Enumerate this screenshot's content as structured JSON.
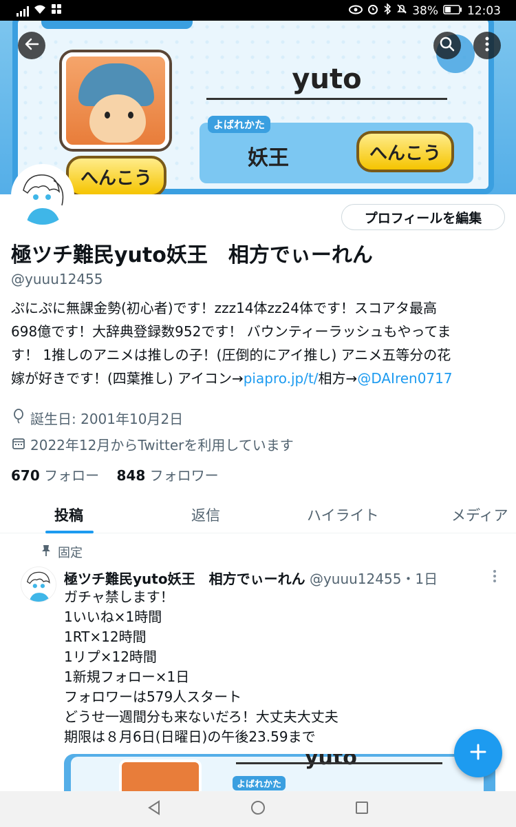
{
  "status_bar": {
    "battery": "38%",
    "time": "12:03"
  },
  "banner": {
    "name_text": "yuto",
    "yobarekata_label": "よばれかた",
    "yobarekata_value": "妖王",
    "henkou_button_1": "へんこう",
    "henkou_button_2": "へんこう"
  },
  "header": {
    "back_icon": "arrow-left-icon",
    "search_icon": "search-icon",
    "more_icon": "more-vertical-icon"
  },
  "profile": {
    "edit_button": "プロフィールを編集",
    "display_name": "極ツチ難民yuto妖王　相方でぃーれん",
    "handle": "@yuuu12455",
    "bio_line1": "ぷにぷに無課金勢(初心者)です！zzz14体zz24体です！スコアタ最高",
    "bio_line2": "698億です！大辞典登録数952です！ バウンティーラッシュもやってま",
    "bio_line3": "す！ 1推しのアニメは推しの子！(圧倒的にアイ推し) アニメ五等分の花",
    "bio_line4_prefix": "嫁が好きです！(四葉推し) アイコン→",
    "bio_link1": "piapro.jp/t/",
    "bio_line4_mid": "相方→",
    "bio_link2": "@DAIren0717",
    "birthday": "誕生日: 2001年10月2日",
    "joined": "2022年12月からTwitterを利用しています",
    "following_count": "670",
    "following_label": "フォロー",
    "followers_count": "848",
    "followers_label": "フォロワー"
  },
  "tabs": [
    {
      "label": "投稿"
    },
    {
      "label": "返信"
    },
    {
      "label": "ハイライト"
    },
    {
      "label": "メディア"
    }
  ],
  "pinned_post": {
    "pinned_label": "固定",
    "author_name": "極ツチ難民yuto妖王　相方でぃーれん",
    "author_handle": "@yuuu12455",
    "time": "・1日",
    "lines": [
      "ガチャ禁します！",
      "1いいね×1時間",
      "1RT×12時間",
      "1リプ×12時間",
      "1新規フォロー×1日",
      "フォロワーは579人スタート",
      "どうせ一週間分も来ないだろ！大丈夫大丈夫",
      "期限は８月6日(日曜日)の午後23.59まで"
    ],
    "image_name_text": "yuto",
    "image_label": "よばれかた"
  },
  "colors": {
    "accent": "#1d9bf0",
    "secondary_text": "#536471",
    "primary_text": "#0f1419"
  }
}
